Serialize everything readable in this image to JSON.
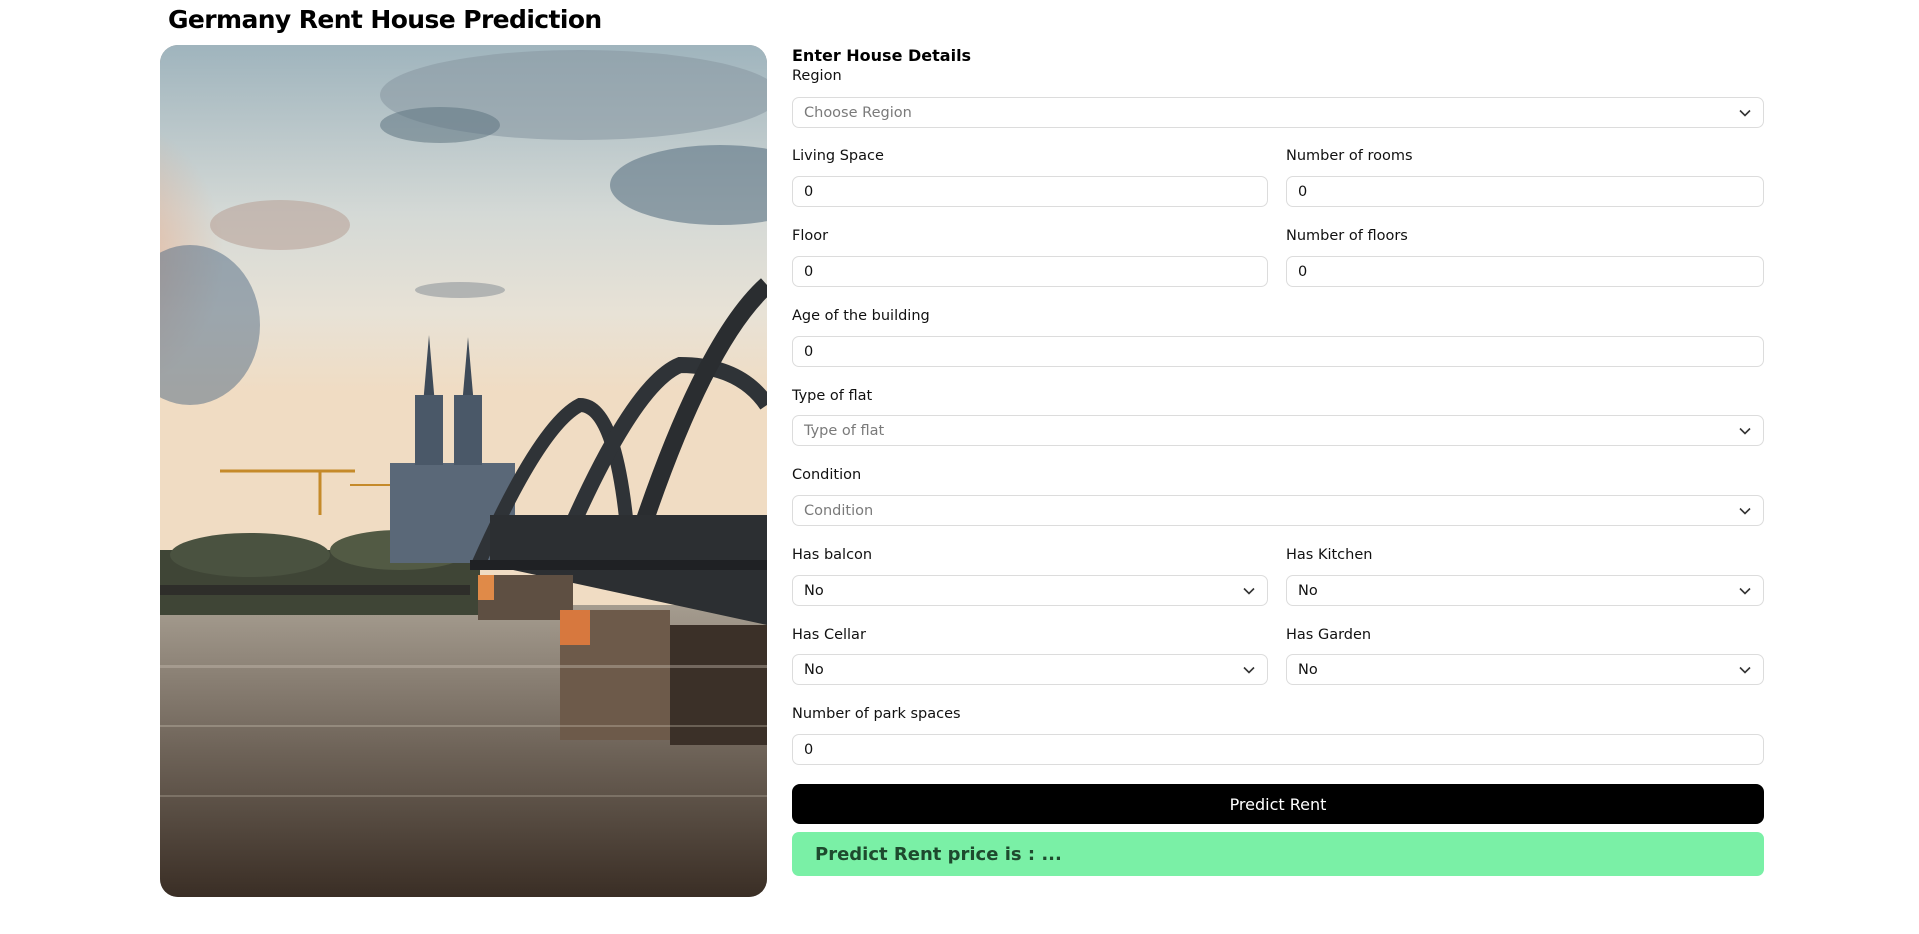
{
  "page": {
    "title": "Germany Rent House Prediction"
  },
  "form": {
    "heading": "Enter House Details",
    "region": {
      "label": "Region",
      "placeholder": "Choose Region"
    },
    "living_space": {
      "label": "Living Space",
      "value": "0"
    },
    "rooms": {
      "label": "Number of rooms",
      "value": "0"
    },
    "floor": {
      "label": "Floor",
      "value": "0"
    },
    "floors": {
      "label": "Number of floors",
      "value": "0"
    },
    "age": {
      "label": "Age of the building",
      "value": "0"
    },
    "flat_type": {
      "label": "Type of flat",
      "placeholder": "Type of flat"
    },
    "condition": {
      "label": "Condition",
      "placeholder": "Condition"
    },
    "balcon": {
      "label": "Has balcon",
      "value": "No"
    },
    "kitchen": {
      "label": "Has Kitchen",
      "value": "No"
    },
    "cellar": {
      "label": "Has Cellar",
      "value": "No"
    },
    "garden": {
      "label": "Has Garden",
      "value": "No"
    },
    "park": {
      "label": "Number of park spaces",
      "value": "0"
    },
    "submit_label": "Predict Rent",
    "result_text": "Predict Rent price is : ..."
  },
  "icons": {
    "dropdown": "chevron-down-icon"
  },
  "colors": {
    "button": "#000000",
    "result_bg": "#7af0a6",
    "result_text": "#1e4a2e"
  }
}
